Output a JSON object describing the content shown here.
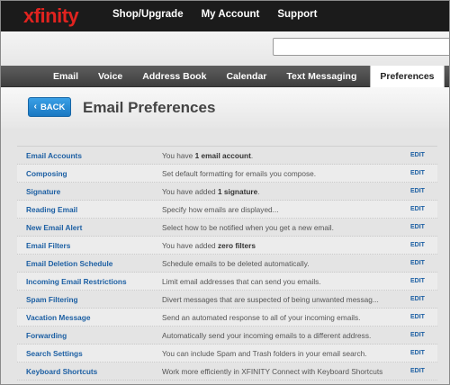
{
  "header": {
    "logo": "xfinity",
    "nav": [
      "Shop/Upgrade",
      "My Account",
      "Support"
    ]
  },
  "search": {
    "value": "",
    "placeholder": ""
  },
  "tabs": [
    {
      "label": "Email"
    },
    {
      "label": "Voice"
    },
    {
      "label": "Address Book"
    },
    {
      "label": "Calendar"
    },
    {
      "label": "Text Messaging"
    },
    {
      "label": "Preferences",
      "active": true
    }
  ],
  "page": {
    "back_label": "BACK",
    "title": "Email Preferences"
  },
  "settings": [
    {
      "name": "Email Accounts",
      "desc_pre": "You have ",
      "desc_bold": "1 email account",
      "desc_post": ".",
      "edit": "EDIT"
    },
    {
      "name": "Composing",
      "desc_pre": "Set default formatting for emails you compose.",
      "desc_bold": "",
      "desc_post": "",
      "edit": "EDIT"
    },
    {
      "name": "Signature",
      "desc_pre": "You have added ",
      "desc_bold": "1 signature",
      "desc_post": ".",
      "edit": "EDIT"
    },
    {
      "name": "Reading Email",
      "desc_pre": "Specify how emails are displayed...",
      "desc_bold": "",
      "desc_post": "",
      "edit": "EDIT"
    },
    {
      "name": "New Email Alert",
      "desc_pre": "Select how to be notified when you get a new email.",
      "desc_bold": "",
      "desc_post": "",
      "edit": "EDIT"
    },
    {
      "name": "Email Filters",
      "desc_pre": "You have added ",
      "desc_bold": "zero filters",
      "desc_post": "",
      "edit": "EDIT"
    },
    {
      "name": "Email Deletion Schedule",
      "desc_pre": "Schedule emails to be deleted automatically.",
      "desc_bold": "",
      "desc_post": "",
      "edit": "EDIT"
    },
    {
      "name": "Incoming Email Restrictions",
      "desc_pre": "Limit email addresses that can send you emails.",
      "desc_bold": "",
      "desc_post": "",
      "edit": "EDIT"
    },
    {
      "name": "Spam Filtering",
      "desc_pre": "Divert messages that are suspected of being unwanted messag...",
      "desc_bold": "",
      "desc_post": "",
      "edit": "EDIT"
    },
    {
      "name": "Vacation Message",
      "desc_pre": "Send an automated response to all of your incoming emails.",
      "desc_bold": "",
      "desc_post": "",
      "edit": "EDIT"
    },
    {
      "name": "Forwarding",
      "desc_pre": "Automatically send your incoming emails to a different address.",
      "desc_bold": "",
      "desc_post": "",
      "edit": "EDIT"
    },
    {
      "name": "Search Settings",
      "desc_pre": "You can include Spam and Trash folders in your email search.",
      "desc_bold": "",
      "desc_post": "",
      "edit": "EDIT"
    },
    {
      "name": "Keyboard Shortcuts",
      "desc_pre": "Work more efficiently in XFINITY Connect with Keyboard Shortcuts",
      "desc_bold": "",
      "desc_post": "",
      "edit": "EDIT"
    }
  ]
}
